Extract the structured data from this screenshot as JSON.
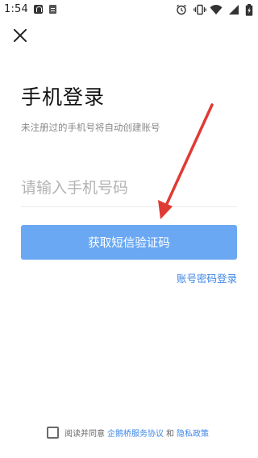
{
  "status_bar": {
    "time": "1:54",
    "icons": [
      "notification-a-icon",
      "document-icon",
      "alarm-icon",
      "vibrate-icon",
      "wifi-icon",
      "signal-icon",
      "battery-icon"
    ]
  },
  "login": {
    "title": "手机登录",
    "subtitle": "未注册过的手机号将自动创建账号",
    "phone_placeholder": "请输入手机号码",
    "phone_value": "",
    "submit_label": "获取短信验证码",
    "password_login_link": "账号密码登录"
  },
  "agreement": {
    "checked": false,
    "prefix": "阅读并同意",
    "service_link": "企鹅桥服务协议",
    "conjunction": "和",
    "privacy_link": "隐私政策"
  },
  "colors": {
    "primary_button": "#6aa8f3",
    "link": "#3e86e6",
    "annotation_arrow": "#e03a34"
  }
}
